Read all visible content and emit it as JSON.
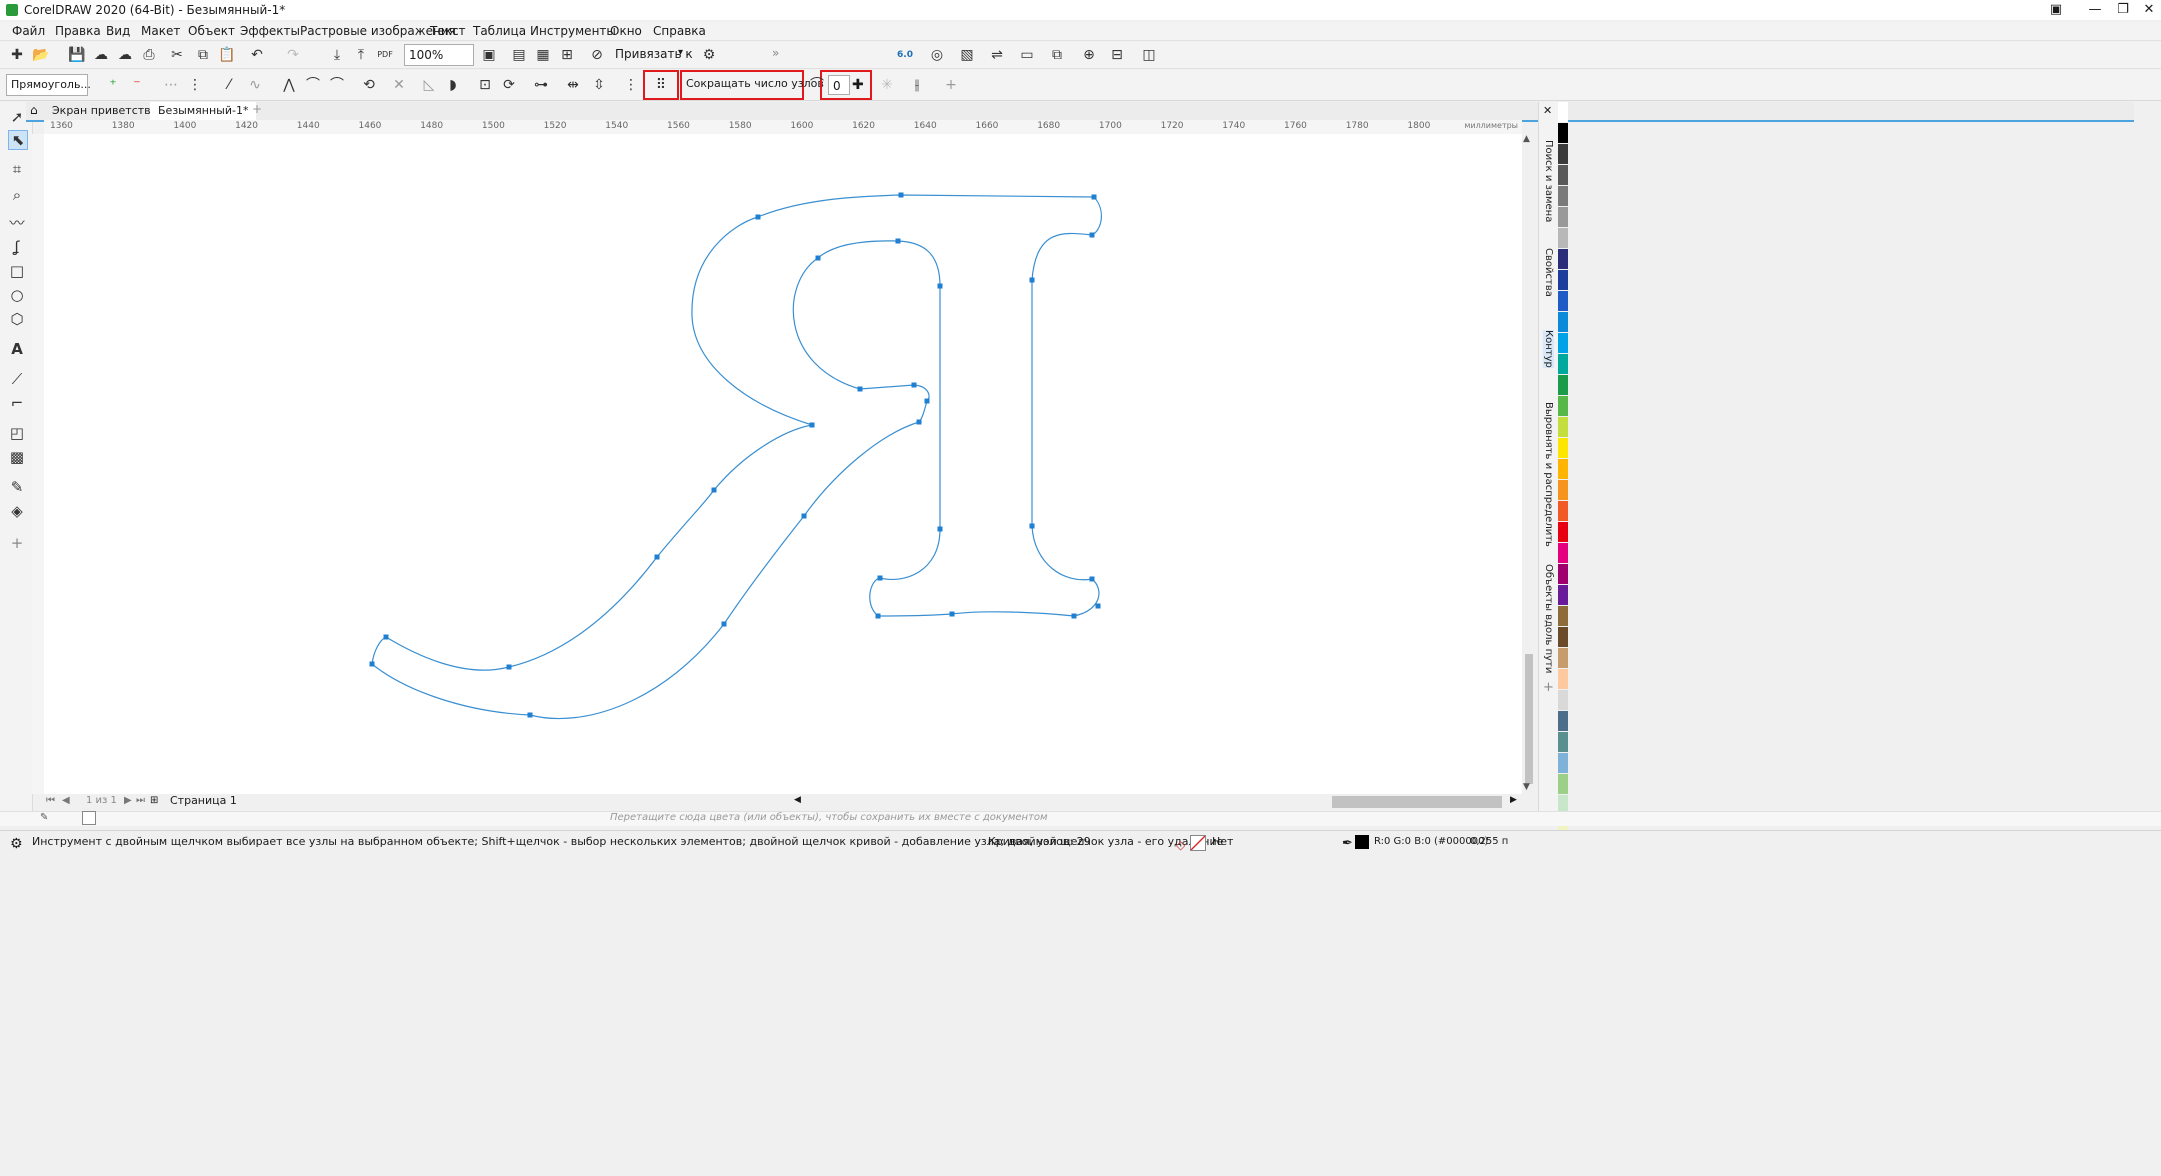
{
  "app": {
    "title": "CorelDRAW 2020 (64-Bit) - Безымянный-1*"
  },
  "menu": [
    "Файл",
    "Правка",
    "Вид",
    "Макет",
    "Объект",
    "Эффекты",
    "Растровые изображения",
    "Текст",
    "Таблица",
    "Инструменты",
    "Окно",
    "Справка"
  ],
  "toolbar": {
    "zoom": "100%",
    "snap_label": "Привязать к",
    "version_badge": "6.0",
    "pdf_label": "PDF"
  },
  "property_bar": {
    "selection_mode": "Прямоуголь...",
    "reduce_nodes_label": "Сокращать число узлов",
    "smoothing_value": "0"
  },
  "tabs": {
    "welcome": "Экран приветствия",
    "document": "Безымянный-1*"
  },
  "ruler": {
    "ticks": [
      "1360",
      "1380",
      "1400",
      "1420",
      "1440",
      "1460",
      "1480",
      "1500",
      "1520",
      "1540",
      "1560",
      "1580",
      "1600",
      "1620",
      "1640",
      "1660",
      "1680",
      "1700",
      "1720",
      "1740",
      "1760",
      "1780",
      "1800"
    ],
    "unit": "миллиметры"
  },
  "docker": {
    "tab1": "Поиск и замена",
    "tab2": "Свойства",
    "tab3": "Контур",
    "tab4": "Выровнять и распределить",
    "tab5": "Объекты вдоль пути"
  },
  "page_nav": {
    "count": "1 из 1",
    "page_label": "Страница 1"
  },
  "color_drop_hint": "Перетащите сюда цвета (или объекты), чтобы сохранить их вместе с документом",
  "status": {
    "hint": "Инструмент с двойным щелчком выбирает все узлы на выбранном объекте; Shift+щелчок - выбор нескольких элементов; двойной щелчок кривой - добавление узла; двойной щелчок узла - его удаление",
    "object_info": "Кривая, узлов: 29",
    "fill_label": "Нет",
    "outline_color": "R:0 G:0 B:0 (#000000)",
    "outline_width": "0,255 п"
  },
  "colors": {
    "curve": "#3a8fd1",
    "highlight": "#e0191c",
    "accent": "#4ca3dd"
  }
}
